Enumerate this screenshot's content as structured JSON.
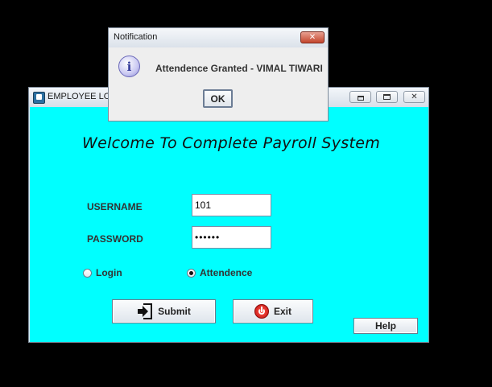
{
  "main_window": {
    "title": "EMPLOYEE LO",
    "welcome_text": "Welcome To Complete Payroll System",
    "form": {
      "username_label": "USERNAME",
      "password_label": "PASSWORD",
      "username_value": "101",
      "password_value": "••••••"
    },
    "radios": {
      "login_label": "Login",
      "attendence_label": "Attendence",
      "selected": "Attendence"
    },
    "buttons": {
      "submit_label": "Submit",
      "exit_label": "Exit",
      "help_label": "Help"
    },
    "content_bg": "#00ffff"
  },
  "dialog": {
    "title": "Notification",
    "message": "Attendence Granted - VIMAL TIWARI",
    "ok_label": "OK",
    "icon": "info-icon"
  },
  "icons": {
    "close": "✕",
    "info": "i"
  }
}
